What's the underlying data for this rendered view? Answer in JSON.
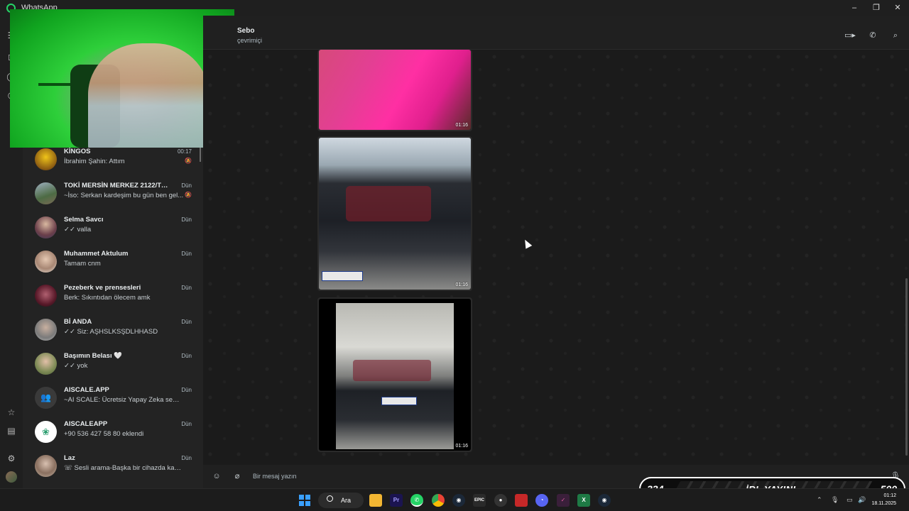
{
  "window": {
    "title": "WhatsApp",
    "controls": {
      "minimize": "–",
      "maximize": "❐",
      "close": "✕"
    }
  },
  "rail": {
    "icons": [
      "menu-icon",
      "chats-icon",
      "status-icon",
      "channels-icon",
      "starred-icon",
      "archive-icon",
      "settings-icon",
      "profile-avatar"
    ]
  },
  "chat_list": {
    "items": [
      {
        "name": "KİNGOS",
        "time": "00:17",
        "preview": "İbrahim Şahin: Attım",
        "muted": true,
        "avatar_color": "#c9a227"
      },
      {
        "name": "TOKİ MERSİN MERKEZ 2122/TOR...",
        "time": "Dün",
        "preview": "~İso: Serkan kardeşim bu gün ben gel...",
        "muted": true,
        "avatar_color": "#6d7f62"
      },
      {
        "name": "Selma Savcı",
        "time": "Dün",
        "preview": "✓✓ valla",
        "muted": false,
        "avatar_color": "#8b6a6a"
      },
      {
        "name": "Muhammet Aktulum",
        "time": "Dün",
        "preview": "Tamam cnm",
        "muted": false,
        "avatar_color": "#b89a84"
      },
      {
        "name": "Pezeberk ve prensesleri",
        "time": "Dün",
        "preview": "Berk: Sıkıntıdan ölecem amk",
        "muted": false,
        "avatar_color": "#7a2f3a"
      },
      {
        "name": "Bİ ANDA",
        "time": "Dün",
        "preview": "✓✓ Siz: AŞHSLKSŞDLHHASD",
        "muted": false,
        "avatar_color": "#9c9c9c"
      },
      {
        "name": "Başımın Belası 🤍",
        "time": "Dün",
        "preview": "✓✓ yok",
        "muted": false,
        "avatar_color": "#6f8a55"
      },
      {
        "name": "AISCALE.APP",
        "time": "Dün",
        "preview": "~AI SCALE: Ücretsiz Yapay Zeka semine...",
        "muted": false,
        "avatar_color": "#3b3b3b"
      },
      {
        "name": "AISCALEAPP",
        "time": "Dün",
        "preview": "+90 536 427 58 80 eklendi",
        "muted": false,
        "avatar_color": "#ffffff"
      },
      {
        "name": "Laz",
        "time": "Dün",
        "preview": "☏ Sesli arama-Başka bir cihazda kabul...",
        "muted": false,
        "avatar_color": "#a38a7a"
      }
    ]
  },
  "chat_header": {
    "contact_name": "Sebo",
    "status": "çevrimiçi",
    "actions": [
      "video-call-icon",
      "voice-call-icon",
      "search-icon"
    ]
  },
  "messages": [
    {
      "type": "video",
      "duration": "01:16",
      "theme": "pink-interior"
    },
    {
      "type": "video",
      "duration": "01:16",
      "theme": "car-front"
    },
    {
      "type": "video",
      "duration": "01:16",
      "theme": "car-rear"
    }
  ],
  "composer": {
    "placeholder": "Bir mesaj yazın",
    "left_icons": [
      "emoji-icon",
      "attach-icon"
    ],
    "right_icon": "mic-icon"
  },
  "stream_overlay": {
    "left_value": "334",
    "center_label": "İRL YAYINI",
    "right_value": "500"
  },
  "taskbar": {
    "search_label": "Ara",
    "apps": [
      "windows-start-icon",
      "file-explorer-icon",
      "premiere-icon",
      "whatsapp-icon",
      "chrome-icon",
      "steam-icon",
      "epic-games-icon",
      "game-app-icon",
      "video-editor-icon",
      "discord-icon",
      "app-icon",
      "excel-icon",
      "steam-2-icon"
    ],
    "app_labels": {
      "premiere": "Pr",
      "epic": "EPIC"
    },
    "clock_time": "01:12",
    "clock_date": "18.11.2025"
  }
}
